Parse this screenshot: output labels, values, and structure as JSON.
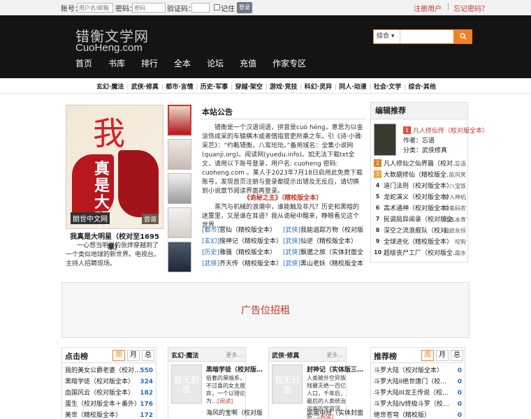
{
  "loginbar": {
    "account_label": "账号：",
    "account_placeholder": "用户名/邮箱",
    "password_label": "密码：",
    "password_placeholder": "密码",
    "captcha_label": "验证码：",
    "remember_label": "记住",
    "login_button": "登录",
    "register": "注册用户",
    "sep": "|",
    "forgot": "忘记密码？"
  },
  "header": {
    "logo_cn": "错衡文学网",
    "logo_en": "CuoHeng.com",
    "search_select": "综合",
    "search_button_icon": "search-icon",
    "nav": [
      "首页",
      "书库",
      "排行",
      "全本",
      "论坛",
      "充值",
      "作家专区"
    ]
  },
  "categories": [
    "玄幻·魔法",
    "武侠·修真",
    "都市·言情",
    "历史·军事",
    "穿越·架空",
    "游戏·竞技",
    "科幻·灵异",
    "同人·动漫",
    "社会·文学",
    "综合·其他"
  ],
  "featured": {
    "cover_big": "我",
    "cover_sub": "真是大明星",
    "cover_pub": "朗世中文网",
    "cover_author": "尝谐",
    "title": "我真是大明星（校对至1695章）",
    "desc": "一心想当明星的张烨穿越到了一个类似地球的新世界。电视台。主持人招聘现场。"
  },
  "notice": {
    "title": "本站公告",
    "body_pre": "错衡是一个汉语词语，拼音是cuò héng，意思为以金涂饰成采的车辕横木或者借指官吏所乘之车。引《诗·小雅·采芑》：“约軧错衡，八鸾玱玱。”备用域名：全集小说网(quanji.org)。阅读网(yuedu.info)。如无法下载txt全文，请用以下账号登录，用户名: cuoheng 密码: cuoheng.com 。某人于2023年7月18日启用此免费下载账号，发现首页注册与登录都提示出错及无反应，请切换到小说章节阅读界面再登录。",
    "headline": "《诡秘之主》（精校版全本）",
    "headline_desc": "蒸汽与机械的浪潮中，谁能触及非凡？历史和黑暗的迷雾里，又是谁在耳语？我从诡秘中醒来，睁眼看见这个世界……",
    "books": [
      [
        {
          "tag": "[都市]",
          "name": "官仙（精校版全本）"
        },
        {
          "tag": "[武侠]",
          "name": "我能追踪万物（校对版…"
        }
      ],
      [
        {
          "tag": "[玄幻]",
          "name": "搜神记（精校版全本）"
        },
        {
          "tag": "[武侠]",
          "name": "仙逆（精校版全本）"
        }
      ],
      [
        {
          "tag": "[历史]",
          "name": "雅骚（精校版全本）"
        },
        {
          "tag": "[武侠]",
          "name": "飘邈之旅（实体封面全…"
        }
      ],
      [
        {
          "tag": "[武侠]",
          "name": "齐天传（精校版全本）"
        },
        {
          "tag": "[武侠]",
          "name": "黑山老妖（精校版全本）"
        }
      ]
    ]
  },
  "edit_recommend": {
    "title": "编辑推荐",
    "top_title": "凡人修仙传（校对版全本）",
    "top_author": "作者：忘语",
    "top_category": "分类：武侠修真",
    "items": [
      {
        "n": "2",
        "name": "凡人修仙之仙界篇（校对…",
        "author": "忘语"
      },
      {
        "n": "3",
        "name": "大数据修仙（精校版全…",
        "author": "陈风笑"
      },
      {
        "n": "4",
        "name": "道门法则（校对版全本）",
        "author": "八宝饭"
      },
      {
        "n": "5",
        "name": "龙蛇演义（校对版全本）",
        "author": "梦入神机"
      },
      {
        "n": "6",
        "name": "高术通神（校对版全本）",
        "author": "徐笔码农"
      },
      {
        "n": "7",
        "name": "民调局异闻录（校对版全…",
        "author": "耳东水寿"
      },
      {
        "n": "8",
        "name": "深空之流浪舰队（校对…",
        "author": "最终永恒"
      },
      {
        "n": "9",
        "name": "全球进化（精校版全本）",
        "author": "咬狗"
      },
      {
        "n": "10",
        "name": "超级丧尸工厂（校对版全…",
        "author": "雨水"
      }
    ]
  },
  "ad": {
    "text": "广告位招租"
  },
  "click_rank": {
    "title": "点击榜",
    "tabs": [
      "周",
      "月",
      "总"
    ],
    "items": [
      {
        "name": "我的美女公爵老婆（校对…",
        "v": "550"
      },
      {
        "name": "黑暗学徒（校对版全本）",
        "v": "324"
      },
      {
        "name": "血国风云（校对版全本）",
        "v": "182"
      },
      {
        "name": "蛋生（校对版全本＋番外）",
        "v": "176"
      },
      {
        "name": "美世（精校版全本）",
        "v": "172"
      }
    ]
  },
  "cat_box_1": {
    "title": "玄幻·魔法",
    "more": "更多...",
    "cover": "暂无封面",
    "book": "黑暗学徒（校对版…",
    "desc": "俗套的黑暗系，不过喜的女主放弃，一个以理论为…",
    "read": "[阅读]",
    "next": "海风的宝啊（校对版"
  },
  "cat_box_2": {
    "title": "武侠·修真",
    "more": "更多...",
    "cover": "暂无封面",
    "book": "封神记（实体版三…",
    "desc": "人类被外空异族残暴灭绝一百亿人口，千年后，最后的人类统治运亮的宇宙河系…",
    "read": "[阅读]",
    "next": "风雷中州（实体封面"
  },
  "recommend_rank": {
    "title": "推荐榜",
    "tabs": [
      "周",
      "月",
      "总"
    ],
    "items": [
      {
        "name": "斗罗大陆（校对版全本）",
        "v": "0"
      },
      {
        "name": "斗罗大陆II绝世唐门（校…",
        "v": "0"
      },
      {
        "name": "斗罗大陆III龙王传说（校…",
        "v": "0"
      },
      {
        "name": "斗罗大陆IV终极斗罗（校…",
        "v": "0"
      },
      {
        "name": "绝世苍穹（精校版）",
        "v": "0"
      }
    ]
  },
  "colors": {
    "accent": "#f08124",
    "brand_red": "#d2342c",
    "header_bg": "#141414"
  }
}
